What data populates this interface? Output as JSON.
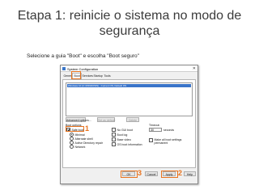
{
  "slide": {
    "title_line1": "Etapa 1: reinicie o sistema no modo de",
    "title_line2": "segurança",
    "instruction": "Selecione a guia \"Boot\" e escolha \"Boot seguro\""
  },
  "dialog": {
    "title": "System Configuration",
    "close_glyph": "✕",
    "tabs": [
      {
        "label": "General"
      },
      {
        "label": "Boot",
        "selected": true
      },
      {
        "label": "Services"
      },
      {
        "label": "Startup"
      },
      {
        "label": "Tools"
      }
    ],
    "os_entry": "Windows 10 (C:\\WINDOWS) : Current OS; Default OS",
    "buttons": {
      "advanced": "Advanced options...",
      "set_default": "Set as default",
      "delete": "Delete",
      "ok": "OK",
      "cancel": "Cancel",
      "apply": "Apply",
      "help": "Help"
    },
    "boot_options_label": "Boot options",
    "safe_boot": {
      "label": "Safe boot",
      "checked": true
    },
    "safe_modes": [
      {
        "label": "Minimal",
        "selected": true
      },
      {
        "label": "Alternate shell",
        "selected": false
      },
      {
        "label": "Active Directory repair",
        "selected": false
      },
      {
        "label": "Network",
        "selected": false
      }
    ],
    "right_options": [
      {
        "label": "No GUI boot",
        "checked": false
      },
      {
        "label": "Boot log",
        "checked": false
      },
      {
        "label": "Base video",
        "checked": false
      },
      {
        "label": "OS boot information",
        "checked": false
      }
    ],
    "timeout": {
      "label": "Timeout:",
      "value": "30",
      "unit": "seconds"
    },
    "make_permanent": {
      "label": "Make all boot settings permanent",
      "checked": false
    }
  },
  "annotations": {
    "step1": "1",
    "step2": "2",
    "step3": "3",
    "accent_color": "#e8731e"
  }
}
